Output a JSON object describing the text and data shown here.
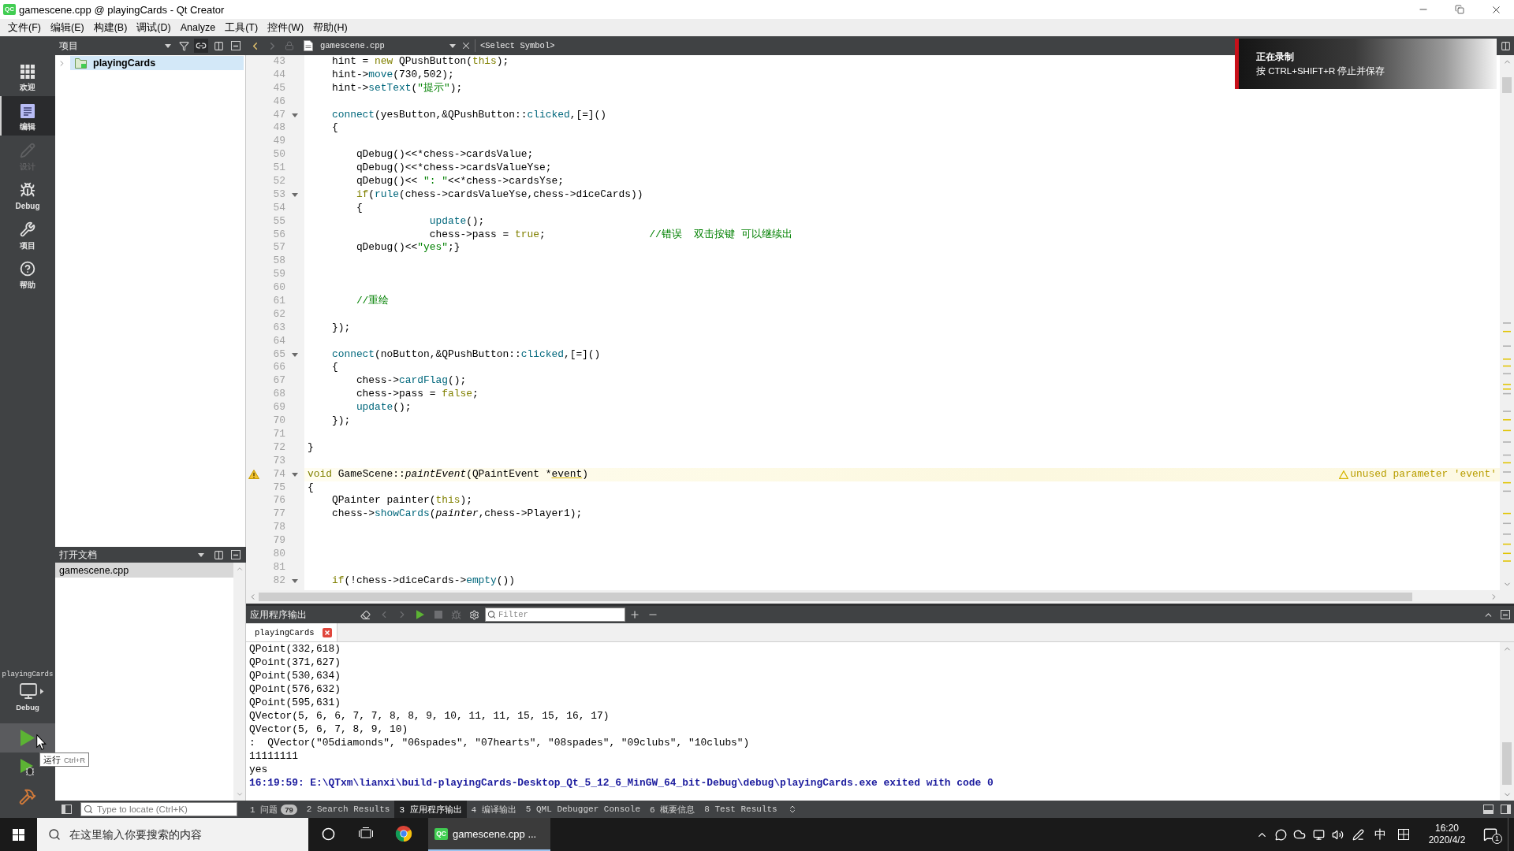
{
  "window": {
    "logo": "QC",
    "title": "gamescene.cpp @ playingCards - Qt Creator"
  },
  "menu": [
    "文件(F)",
    "编辑(E)",
    "构建(B)",
    "调试(D)",
    "Analyze",
    "工具(T)",
    "控件(W)",
    "帮助(H)"
  ],
  "mode_bar": {
    "items": [
      {
        "kind": "welcome",
        "label": "欢迎",
        "selected": false,
        "disabled": false
      },
      {
        "kind": "edit",
        "label": "编辑",
        "selected": true,
        "disabled": false
      },
      {
        "kind": "design",
        "label": "设计",
        "selected": false,
        "disabled": true
      },
      {
        "kind": "debug",
        "label": "Debug",
        "selected": false,
        "disabled": false
      },
      {
        "kind": "projects",
        "label": "项目",
        "selected": false,
        "disabled": false
      },
      {
        "kind": "help",
        "label": "帮助",
        "selected": false,
        "disabled": false
      }
    ],
    "kit": {
      "project": "playingCards",
      "build": "Debug"
    },
    "actions": [
      {
        "kind": "run",
        "hovered": true
      },
      {
        "kind": "debug-run",
        "hovered": false
      },
      {
        "kind": "build",
        "hovered": false
      }
    ],
    "tooltip": {
      "text": "运行",
      "shortcut": "Ctrl+R"
    }
  },
  "projects_panel": {
    "title": "项目",
    "tree": [
      {
        "label": "playingCards",
        "expanded": false,
        "selected": true
      }
    ]
  },
  "open_documents": {
    "title": "打开文档",
    "items": [
      {
        "label": "gamescene.cpp",
        "selected": true
      }
    ]
  },
  "editor": {
    "file": "gamescene.cpp",
    "symbol": "<Select Symbol>",
    "lines": [
      {
        "number": "43",
        "fold": false,
        "segments": [
          {
            "text": "    hint = ",
            "kind": "plain"
          },
          {
            "text": "new",
            "kind": "keyword"
          },
          {
            "text": " QPushButton(",
            "kind": "plain"
          },
          {
            "text": "this",
            "kind": "keyword"
          },
          {
            "text": ");",
            "kind": "plain"
          }
        ]
      },
      {
        "number": "44",
        "fold": false,
        "segments": [
          {
            "text": "    hint->",
            "kind": "plain"
          },
          {
            "text": "move",
            "kind": "function"
          },
          {
            "text": "(730,502);",
            "kind": "plain"
          }
        ]
      },
      {
        "number": "45",
        "fold": false,
        "segments": [
          {
            "text": "    hint->",
            "kind": "plain"
          },
          {
            "text": "setText",
            "kind": "function"
          },
          {
            "text": "(",
            "kind": "plain"
          },
          {
            "text": "\"提示\"",
            "kind": "string"
          },
          {
            "text": ");",
            "kind": "plain"
          }
        ]
      },
      {
        "number": "46",
        "fold": false
      },
      {
        "number": "47",
        "fold": true,
        "segments": [
          {
            "text": "    connect",
            "kind": "function"
          },
          {
            "text": "(yesButton,&QPushButton::",
            "kind": "plain"
          },
          {
            "text": "clicked",
            "kind": "function"
          },
          {
            "text": ",[=]()",
            "kind": "plain"
          }
        ]
      },
      {
        "number": "48",
        "fold": false,
        "segments": [
          {
            "text": "    {",
            "kind": "plain"
          }
        ]
      },
      {
        "number": "49",
        "fold": false
      },
      {
        "number": "50",
        "fold": false,
        "segments": [
          {
            "text": "        qDebug()<<*chess->cardsValue;",
            "kind": "plain"
          }
        ]
      },
      {
        "number": "51",
        "fold": false,
        "segments": [
          {
            "text": "        qDebug()<<*chess->cardsValueYse;",
            "kind": "plain"
          }
        ]
      },
      {
        "number": "52",
        "fold": false,
        "segments": [
          {
            "text": "        qDebug()<< ",
            "kind": "plain"
          },
          {
            "text": "\": \"",
            "kind": "string"
          },
          {
            "text": "<<*chess->cardsYse;",
            "kind": "plain"
          }
        ]
      },
      {
        "number": "53",
        "fold": true,
        "segments": [
          {
            "text": "        if",
            "kind": "keyword"
          },
          {
            "text": "(",
            "kind": "plain"
          },
          {
            "text": "rule",
            "kind": "function"
          },
          {
            "text": "(chess->cardsValueYse,chess->diceCards))",
            "kind": "plain"
          }
        ]
      },
      {
        "number": "54",
        "fold": false,
        "segments": [
          {
            "text": "        {",
            "kind": "plain"
          }
        ]
      },
      {
        "number": "55",
        "fold": false,
        "segments": [
          {
            "text": "                    update",
            "kind": "function"
          },
          {
            "text": "();",
            "kind": "plain"
          }
        ]
      },
      {
        "number": "56",
        "fold": false,
        "segments": [
          {
            "text": "                    chess->pass = ",
            "kind": "plain"
          },
          {
            "text": "true",
            "kind": "keyword"
          },
          {
            "text": ";                 ",
            "kind": "plain"
          },
          {
            "text": "//错误  双击按键 可以继续出",
            "kind": "comment"
          }
        ]
      },
      {
        "number": "57",
        "fold": false,
        "segments": [
          {
            "text": "        qDebug()<<",
            "kind": "plain"
          },
          {
            "text": "\"yes\"",
            "kind": "string"
          },
          {
            "text": ";}",
            "kind": "plain"
          }
        ]
      },
      {
        "number": "58",
        "fold": false
      },
      {
        "number": "59",
        "fold": false
      },
      {
        "number": "60",
        "fold": false
      },
      {
        "number": "61",
        "fold": false,
        "segments": [
          {
            "text": "        //重绘",
            "kind": "comment"
          }
        ]
      },
      {
        "number": "62",
        "fold": false
      },
      {
        "number": "63",
        "fold": false,
        "segments": [
          {
            "text": "    });",
            "kind": "plain"
          }
        ]
      },
      {
        "number": "64",
        "fold": false
      },
      {
        "number": "65",
        "fold": true,
        "segments": [
          {
            "text": "    connect",
            "kind": "function"
          },
          {
            "text": "(noButton,&QPushButton::",
            "kind": "plain"
          },
          {
            "text": "clicked",
            "kind": "function"
          },
          {
            "text": ",[=]()",
            "kind": "plain"
          }
        ]
      },
      {
        "number": "66",
        "fold": false,
        "segments": [
          {
            "text": "    {",
            "kind": "plain"
          }
        ]
      },
      {
        "number": "67",
        "fold": false,
        "segments": [
          {
            "text": "        chess->",
            "kind": "plain"
          },
          {
            "text": "cardFlag",
            "kind": "function"
          },
          {
            "text": "();",
            "kind": "plain"
          }
        ]
      },
      {
        "number": "68",
        "fold": false,
        "segments": [
          {
            "text": "        chess->pass = ",
            "kind": "plain"
          },
          {
            "text": "false",
            "kind": "keyword"
          },
          {
            "text": ";",
            "kind": "plain"
          }
        ]
      },
      {
        "number": "69",
        "fold": false,
        "segments": [
          {
            "text": "        update",
            "kind": "function"
          },
          {
            "text": "();",
            "kind": "plain"
          }
        ]
      },
      {
        "number": "70",
        "fold": false,
        "segments": [
          {
            "text": "    });",
            "kind": "plain"
          }
        ]
      },
      {
        "number": "71",
        "fold": false
      },
      {
        "number": "72",
        "fold": false,
        "segments": [
          {
            "text": "}",
            "kind": "plain"
          }
        ]
      },
      {
        "number": "73",
        "fold": false
      },
      {
        "number": "74",
        "fold": true,
        "warning": "unused parameter 'event'",
        "segments": [
          {
            "text": "void",
            "kind": "keyword"
          },
          {
            "text": " GameScene::",
            "kind": "plain"
          },
          {
            "text": "paintEvent",
            "kind": "virtual"
          },
          {
            "text": "(QPaintEvent *",
            "kind": "plain"
          },
          {
            "text": "event",
            "kind": "flagged"
          },
          {
            "text": ")",
            "kind": "plain"
          }
        ]
      },
      {
        "number": "75",
        "fold": false,
        "segments": [
          {
            "text": "{",
            "kind": "plain"
          }
        ]
      },
      {
        "number": "76",
        "fold": false,
        "segments": [
          {
            "text": "    QPainter painter(",
            "kind": "plain"
          },
          {
            "text": "this",
            "kind": "keyword"
          },
          {
            "text": ");",
            "kind": "plain"
          }
        ]
      },
      {
        "number": "77",
        "fold": false,
        "segments": [
          {
            "text": "    chess->",
            "kind": "plain"
          },
          {
            "text": "showCards",
            "kind": "function"
          },
          {
            "text": "(",
            "kind": "plain"
          },
          {
            "text": "painter",
            "kind": "local"
          },
          {
            "text": ",chess->Player1);",
            "kind": "plain"
          }
        ]
      },
      {
        "number": "78",
        "fold": false
      },
      {
        "number": "79",
        "fold": false
      },
      {
        "number": "80",
        "fold": false
      },
      {
        "number": "81",
        "fold": false
      },
      {
        "number": "82",
        "fold": true,
        "segments": [
          {
            "text": "    if",
            "kind": "keyword"
          },
          {
            "text": "(!chess->diceCards->",
            "kind": "plain"
          },
          {
            "text": "empty",
            "kind": "function"
          },
          {
            "text": "())",
            "kind": "plain"
          }
        ]
      }
    ]
  },
  "recording_notice": {
    "title": "正在录制",
    "hint": "按 CTRL+SHIFT+R 停止并保存"
  },
  "output_pane": {
    "title": "应用程序输出",
    "filter": {
      "placeholder": "Filter"
    },
    "tabs": [
      {
        "label": "playingCards",
        "selected": true
      }
    ],
    "lines": [
      {
        "text": "QPoint(332,618)",
        "kind": "stdout"
      },
      {
        "text": "QPoint(371,627)",
        "kind": "stdout"
      },
      {
        "text": "QPoint(530,634)",
        "kind": "stdout"
      },
      {
        "text": "QPoint(576,632)",
        "kind": "stdout"
      },
      {
        "text": "QPoint(595,631)",
        "kind": "stdout"
      },
      {
        "text": "QVector(5, 6, 6, 7, 7, 8, 8, 9, 10, 11, 11, 15, 15, 16, 17)",
        "kind": "stdout"
      },
      {
        "text": "QVector(5, 6, 7, 8, 9, 10)",
        "kind": "stdout"
      },
      {
        "text": ":  QVector(\"05diamonds\", \"06spades\", \"07hearts\", \"08spades\", \"09clubs\", \"10clubs\")",
        "kind": "stdout"
      },
      {
        "text": "11111111",
        "kind": "stdout"
      },
      {
        "text": "yes",
        "kind": "stdout"
      },
      {
        "text": "16:19:59: E:\\QTxm\\lianxi\\build-playingCards-Desktop_Qt_5_12_6_MinGW_64_bit-Debug\\debug\\playingCards.exe exited with code 0",
        "kind": "exit"
      }
    ]
  },
  "status_bar": {
    "locator": {
      "placeholder": "Type to locate (Ctrl+K)"
    },
    "panes": [
      {
        "label": "1 问题",
        "badge": "79",
        "selected": false
      },
      {
        "label": "2 Search Results",
        "selected": false
      },
      {
        "label": "3 应用程序输出",
        "selected": true
      },
      {
        "label": "4 编译输出",
        "selected": false
      },
      {
        "label": "5 QML Debugger Console",
        "selected": false
      },
      {
        "label": "6 概要信息",
        "selected": false
      },
      {
        "label": "8 Test Results",
        "selected": false
      }
    ]
  },
  "taskbar": {
    "search": {
      "placeholder": "在这里输入你要搜索的内容"
    },
    "apps": [
      {
        "kind": "cortana",
        "active": false
      },
      {
        "kind": "task-view",
        "active": false
      },
      {
        "kind": "browser",
        "active": false
      },
      {
        "kind": "window",
        "logo": "QC",
        "label": "gamescene.cpp ...",
        "active": true
      }
    ],
    "tray": {
      "ime": "中",
      "time": "16:20",
      "date": "2020/4/2",
      "notifications": "1"
    }
  }
}
